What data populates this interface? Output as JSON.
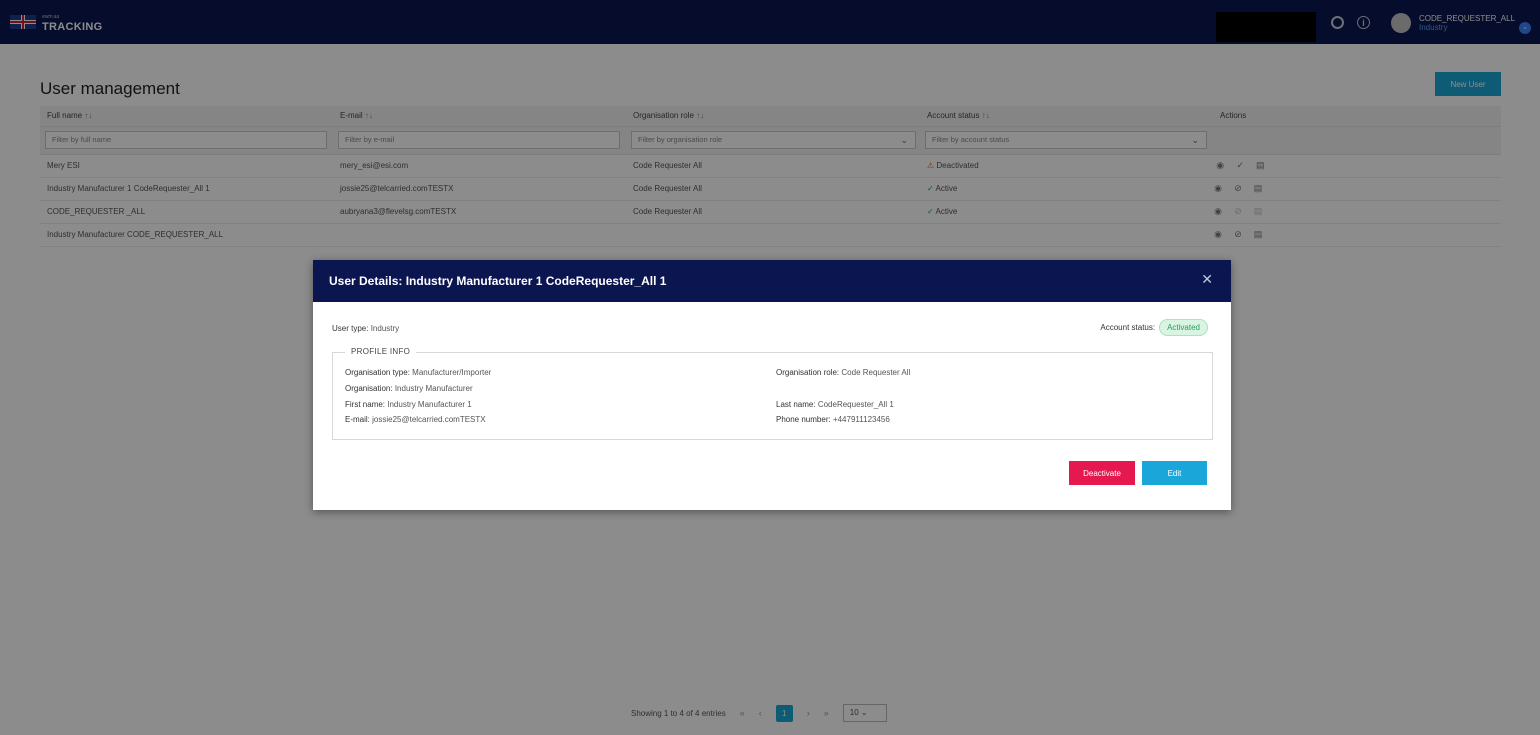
{
  "header": {
    "logo_small": "ewm aa",
    "logo_text": "TRACKING",
    "user_name": "CODE_REQUESTER_ALL",
    "user_org": "Industry",
    "info_glyph": "i",
    "menu_glyph": "⌄"
  },
  "page": {
    "title": "User management",
    "new_user_label": "New User",
    "sort_glyph": "↑↓",
    "filter_chevron": "⌄"
  },
  "table": {
    "columns": [
      "Full name",
      "E-mail",
      "Organisation role",
      "Account status",
      "Actions"
    ],
    "filters": {
      "full_name": "Filter by full name",
      "email": "Filter by e-mail",
      "role": "Filter by organisation role",
      "status": "Filter by account status"
    },
    "rows": [
      {
        "name": "Mery ESI",
        "email": "mery_esi@esi.com",
        "role": "Code Requester All",
        "status_icon": "⚠",
        "status": "Deactivated"
      },
      {
        "name": "Industry Manufacturer 1 CodeRequester_All 1",
        "email": "jossie25@telcarried.comTESTX",
        "role": "Code Requester All",
        "status_icon": "✓",
        "status": "Active"
      },
      {
        "name": "CODE_REQUESTER _ALL",
        "email": "aubryana3@flevelsg.comTESTX",
        "role": "Code Requester All",
        "status_icon": "✓",
        "status": "Active"
      },
      {
        "name": "Industry Manufacturer CODE_REQUESTER_ALL",
        "email": "",
        "role": "",
        "status_icon": "",
        "status": ""
      }
    ],
    "action_icons": {
      "view": "◉",
      "activate": "✓",
      "deactivate": "⊘",
      "delete": "▤"
    }
  },
  "pagination": {
    "summary": "Showing 1 to 4 of 4 entries",
    "first": "«",
    "prev": "‹",
    "current": "1",
    "next": "›",
    "last": "»",
    "page_size": "10",
    "page_size_chevron": "⌄"
  },
  "modal": {
    "title": "User Details: Industry Manufacturer 1 CodeRequester_All 1",
    "close": "✕",
    "user_type_label": "User type:",
    "user_type_value": "Industry",
    "account_status_label": "Account status:",
    "account_status_value": "Activated",
    "section_title": "PROFILE INFO",
    "fields": {
      "org_type_label": "Organisation type:",
      "org_type_value": "Manufacturer/Importer",
      "org_label": "Organisation:",
      "org_value": "Industry Manufacturer",
      "first_name_label": "First name:",
      "first_name_value": "Industry Manufacturer 1",
      "email_label": "E-mail:",
      "email_value": "jossie25@telcarried.comTESTX",
      "org_role_label": "Organisation role:",
      "org_role_value": "Code Requester All",
      "last_name_label": "Last name:",
      "last_name_value": "CodeRequester_All 1",
      "phone_label": "Phone number:",
      "phone_value": "+447911123456"
    },
    "deactivate_label": "Deactivate",
    "edit_label": "Edit"
  },
  "colors": {
    "navy": "#0b1650",
    "accent": "#1aa6d8",
    "danger": "#e5184f",
    "success": "#2a9b5a",
    "warning": "#e06b18"
  }
}
